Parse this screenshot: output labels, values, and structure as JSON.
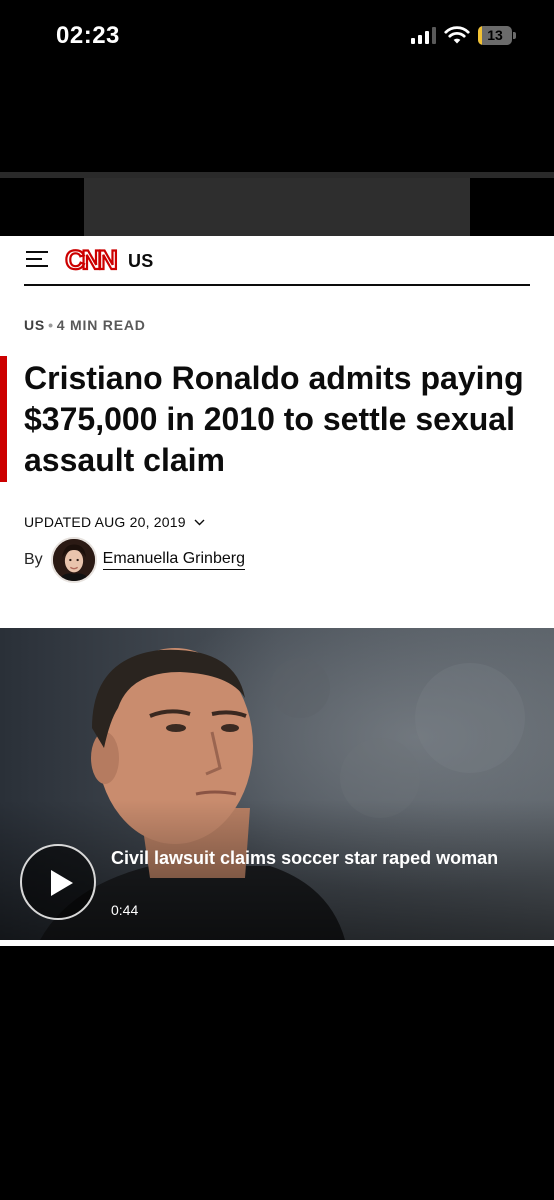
{
  "status_bar": {
    "time": "02:23",
    "battery_level": "13",
    "battery_color": "#f3c233"
  },
  "cnn": {
    "logo_text": "CNN",
    "edition": "US",
    "brand_color": "#cc0000"
  },
  "article": {
    "section": "US",
    "separator": "•",
    "read_time": "4 MIN READ",
    "headline": "Cristiano Ronaldo admits paying $375,000 in 2010 to settle sexual assault claim",
    "updated": "UPDATED AUG 20, 2019",
    "byline_prefix": "By",
    "author": "Emanuella Grinberg"
  },
  "video": {
    "title": "Civil lawsuit claims soccer star raped woman",
    "duration": "0:44"
  },
  "icons": {
    "menu": "hamburger-menu-icon",
    "chevron": "chevron-down-icon",
    "play": "play-icon",
    "signal": "cellular-signal-icon",
    "wifi": "wifi-icon",
    "battery": "battery-icon"
  }
}
